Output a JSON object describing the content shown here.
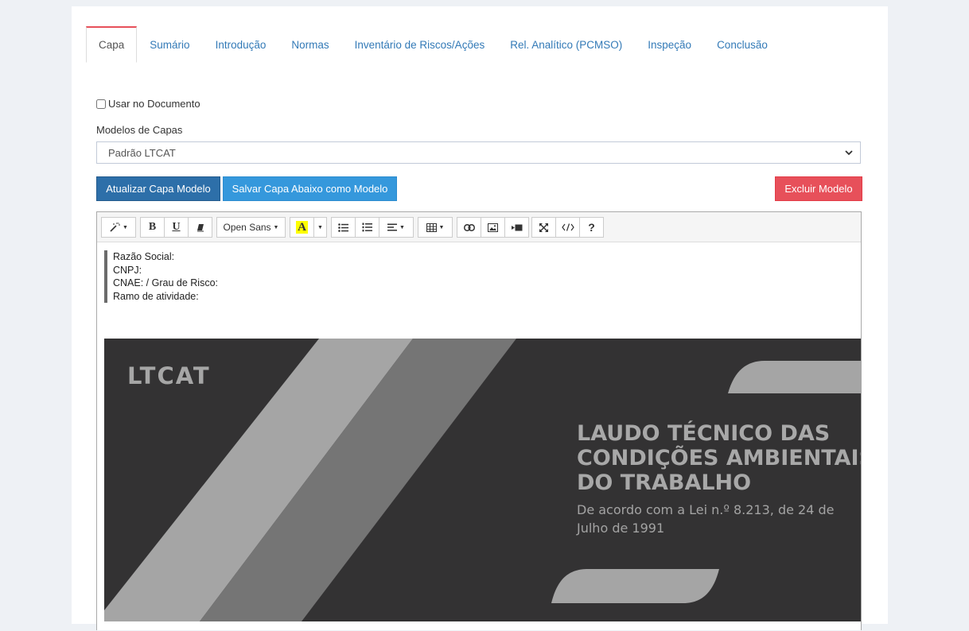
{
  "tabs": [
    {
      "label": "Capa",
      "active": true
    },
    {
      "label": "Sumário"
    },
    {
      "label": "Introdução"
    },
    {
      "label": "Normas"
    },
    {
      "label": "Inventário de Riscos/Ações"
    },
    {
      "label": "Rel. Analítico (PCMSO)"
    },
    {
      "label": "Inspeção"
    },
    {
      "label": "Conclusão"
    }
  ],
  "form": {
    "use_in_document_label": "Usar no Documento",
    "use_in_document_checked": false,
    "models_label": "Modelos de Capas",
    "models_selected": "Padrão LTCAT"
  },
  "buttons": {
    "update": "Atualizar Capa Modelo",
    "save": "Salvar Capa Abaixo como Modelo",
    "delete": "Excluir Modelo"
  },
  "toolbar": {
    "font_name": "Open Sans",
    "bold": "B",
    "underline": "U",
    "color_letter": "A",
    "help": "?",
    "icons": [
      "magic-icon",
      "bold-icon",
      "underline-icon",
      "eraser-icon",
      "font-icon",
      "font-color-icon",
      "unordered-list-icon",
      "ordered-list-icon",
      "align-icon",
      "table-icon",
      "link-icon",
      "picture-icon",
      "video-icon",
      "fullscreen-icon",
      "code-view-icon",
      "help-icon"
    ]
  },
  "content": {
    "company_fields": [
      "Razão Social:",
      "CNPJ:",
      "CNAE: / Grau de Risco:",
      "Ramo de atividade:"
    ],
    "cover": {
      "brand": "LTCAT",
      "title": "LAUDO TÉCNICO DAS\nCONDIÇÕES AMBIENTAIS\nDO TRABALHO",
      "subtitle": "De acordo com a Lei n.º 8.213, de 24 de Julho de 1991"
    }
  },
  "colors": {
    "tab_link": "#337ab7",
    "tab_active_top": "#e7505a",
    "btn_update": "#2d6fa9",
    "btn_save": "#3598dc",
    "btn_delete": "#e7505a",
    "cover_bg": "#333233"
  }
}
